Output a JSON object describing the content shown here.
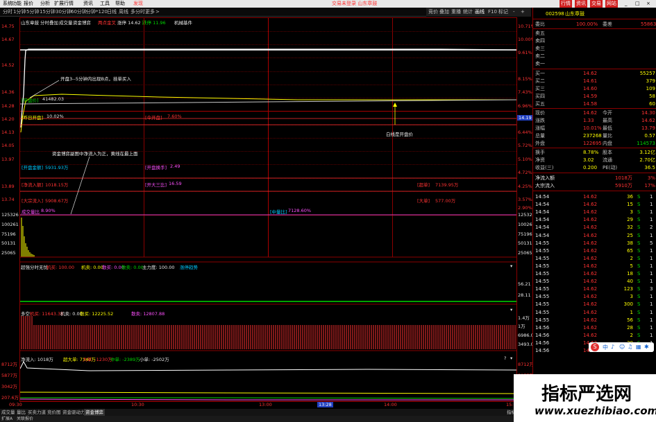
{
  "menubar": {
    "items": [
      "系统",
      "功能",
      "报价",
      "分析",
      "扩展行情",
      "资讯",
      "工具",
      "帮助",
      "发现"
    ],
    "window_title": "交易未登录  山东章鼓",
    "right_buttons": [
      "行情",
      "资讯",
      "交易",
      "网站"
    ]
  },
  "period_bar": {
    "items": [
      "分时",
      "1分钟",
      "5分钟",
      "15分钟",
      "30分钟",
      "60分钟",
      "分钟*120",
      "日线",
      "周线",
      "多分时",
      "更多"
    ]
  },
  "right_toolbar": {
    "items": [
      "竞价",
      "叠加",
      "重播",
      "统计",
      "画线",
      "F10",
      "标记",
      "-",
      "+"
    ]
  },
  "chart": {
    "header": {
      "name": "山东章鼓",
      "tabs": [
        "分时",
        "叠加",
        "成交量",
        "资金博弈",
        "两点金叉",
        "涨停"
      ],
      "price_text": "涨停 14.62",
      "drop_text": "跌停 11.96",
      "sector": "机械基件"
    },
    "left_price_ticks": [
      "14.75",
      "14.67",
      "14.52",
      "14.36",
      "14.28",
      "14.20",
      "14.13",
      "14.05",
      "13.97",
      "13.89",
      "13.74"
    ],
    "right_pct_ticks": [
      "10.71%",
      "10.00%",
      "9.61%",
      "8.15%",
      "7.43%",
      "6.96%",
      "6.44%",
      "5.72%",
      "5.10%",
      "4.72%",
      "4.25%",
      "3.57%",
      "2.90%"
    ],
    "current_price_label": "14.19",
    "volume_left_ticks": [
      "125326",
      "100261",
      "75196",
      "50131",
      "25065"
    ],
    "volume_right_ticks": [
      "125326",
      "100261",
      "75196",
      "50131",
      "25065"
    ],
    "info_labels": {
      "open_label": "[开盘价]",
      "open_value": "41482.03",
      "prev_close_label": "[昨日开盘]",
      "prev_close_value": "10.02%",
      "today_label": "[今开盘]",
      "today_value": "7.60%",
      "money_label": "[开盘金额]",
      "money_value": "5931.93万",
      "turnover_label": "[开盘换手]",
      "turnover_value": "2.49",
      "netflow_label": "[净流入额]",
      "netflow_value": "1018.15万",
      "big3_label": "[开大三比]",
      "big3_value": "16.59",
      "superbig_label": "[超单]",
      "superbig_value": "7139.95万",
      "big_label": "[大宗流入]",
      "big_value": "5908.67万",
      "big2_label": "[大单]",
      "big2_value": "577.00万",
      "ratio_label": "成交量比",
      "ratio_value": "8.90%",
      "total_label": "[中量比]",
      "total_value": "7128.60%"
    },
    "annotations": {
      "a1": "开盘3--5分钟内出现B点，挂单买入",
      "a2": "资金博弈副图中净流入为正，黄线在最上面",
      "a3": "白线是开盘价"
    },
    "panel1": {
      "title": "超强分时无忧",
      "labels": [
        "机买: 100.00",
        "机卖: 0.00",
        "散买: 0.00",
        "散卖: 0.00",
        "主力度: 100.00"
      ],
      "extra": "涨停趋势",
      "right_ticks": [
        "56.21",
        "28.11"
      ]
    },
    "panel2": {
      "title": "多空",
      "labels": [
        "机买: 11643.35",
        "机卖: 0.00",
        "散买: 12225.52",
        "散卖: 12807.88"
      ],
      "right_ticks": [
        "1.4万",
        "1万",
        "6986.01",
        "3493.01"
      ]
    },
    "panel3": {
      "title": "净流入: 1018万",
      "labels": [
        "超大单: 7140万",
        "大单: -1230万",
        "中单: -2389万",
        "小单: -2502万"
      ],
      "left_ticks": [
        "8712万",
        "5877万",
        "3042万",
        "207.6万"
      ],
      "right_ticks": [
        "8712万",
        "5877万",
        "3042万",
        "207.6万"
      ]
    },
    "time_ticks": [
      "09:30",
      "10:30",
      "13:00",
      "13:28",
      "14:00",
      "15:00"
    ]
  },
  "quote": {
    "code": "002598",
    "name": "山东章鼓",
    "webi_label": "委比",
    "webi_value": "100.00%",
    "weicha_label": "委差",
    "weicha_value": "55863",
    "sell": [
      {
        "label": "卖五",
        "price": "",
        "vol": ""
      },
      {
        "label": "卖四",
        "price": "",
        "vol": ""
      },
      {
        "label": "卖三",
        "price": "",
        "vol": ""
      },
      {
        "label": "卖二",
        "price": "",
        "vol": ""
      },
      {
        "label": "卖一",
        "price": "",
        "vol": ""
      }
    ],
    "buy": [
      {
        "label": "买一",
        "price": "14.62",
        "vol": "55257"
      },
      {
        "label": "买二",
        "price": "14.61",
        "vol": "379"
      },
      {
        "label": "买三",
        "price": "14.60",
        "vol": "109"
      },
      {
        "label": "买四",
        "price": "14.59",
        "vol": "58"
      },
      {
        "label": "买五",
        "price": "14.58",
        "vol": "60"
      }
    ],
    "stats": [
      {
        "l1": "现价",
        "v1": "14.62",
        "l2": "今开",
        "v2": "14.30"
      },
      {
        "l1": "涨跌",
        "v1": "1.33",
        "l2": "最高",
        "v2": "14.62"
      },
      {
        "l1": "涨幅",
        "v1": "10.01%",
        "l2": "最低",
        "v2": "13.79"
      },
      {
        "l1": "总量",
        "v1": "237268",
        "l2": "量比",
        "v2": "0.57"
      },
      {
        "l1": "外盘",
        "v1": "122695",
        "l2": "内盘",
        "v2": "114573"
      }
    ],
    "stats2": [
      {
        "l1": "换手",
        "v1": "8.78%",
        "l2": "股本",
        "v2": "3.12亿"
      },
      {
        "l1": "净资",
        "v1": "3.02",
        "l2": "流通",
        "v2": "2.70亿"
      },
      {
        "l1": "收益(三)",
        "v1": "0.200",
        "l2": "PE(动)",
        "v2": "36.5"
      }
    ],
    "flow": [
      {
        "label": "净流入额",
        "value": "1018万",
        "pct": "3%"
      },
      {
        "label": "大宗流入",
        "value": "5910万",
        "pct": "17%"
      }
    ],
    "ticks": [
      {
        "t": "14:54",
        "p": "14.62",
        "v": "36",
        "d": "S",
        "n": "1"
      },
      {
        "t": "14:54",
        "p": "14.62",
        "v": "15",
        "d": "S",
        "n": "1"
      },
      {
        "t": "14:54",
        "p": "14.62",
        "v": "3",
        "d": "S",
        "n": "1"
      },
      {
        "t": "14:54",
        "p": "14.62",
        "v": "29",
        "d": "S",
        "n": "1"
      },
      {
        "t": "14:54",
        "p": "14.62",
        "v": "32",
        "d": "S",
        "n": "2"
      },
      {
        "t": "14:54",
        "p": "14.62",
        "v": "25",
        "d": "S",
        "n": "1"
      },
      {
        "t": "14:55",
        "p": "14.62",
        "v": "38",
        "d": "S",
        "n": "5"
      },
      {
        "t": "14:55",
        "p": "14.62",
        "v": "65",
        "d": "S",
        "n": "1"
      },
      {
        "t": "14:55",
        "p": "14.62",
        "v": "2",
        "d": "S",
        "n": "1"
      },
      {
        "t": "14:55",
        "p": "14.62",
        "v": "5",
        "d": "S",
        "n": "1"
      },
      {
        "t": "14:55",
        "p": "14.62",
        "v": "18",
        "d": "S",
        "n": "1"
      },
      {
        "t": "14:55",
        "p": "14.62",
        "v": "40",
        "d": "S",
        "n": "1"
      },
      {
        "t": "14:55",
        "p": "14.62",
        "v": "123",
        "d": "S",
        "n": "3"
      },
      {
        "t": "14:55",
        "p": "14.62",
        "v": "3",
        "d": "S",
        "n": "1"
      },
      {
        "t": "14:55",
        "p": "14.62",
        "v": "300",
        "d": "S",
        "n": "1"
      },
      {
        "t": "14:55",
        "p": "14.62",
        "v": "1",
        "d": "S",
        "n": "1"
      },
      {
        "t": "14:55",
        "p": "14.62",
        "v": "56",
        "d": "S",
        "n": "1"
      },
      {
        "t": "14:56",
        "p": "14.62",
        "v": "28",
        "d": "S",
        "n": "1"
      },
      {
        "t": "14:56",
        "p": "14.62",
        "v": "2",
        "d": "S",
        "n": "1"
      },
      {
        "t": "14:56",
        "p": "14.62",
        "v": "20",
        "d": "S",
        "n": "1"
      },
      {
        "t": "14:56",
        "p": "14.62",
        "v": "3",
        "d": "S",
        "n": "1"
      }
    ]
  },
  "bottom_tabs": [
    "成交量",
    "量比",
    "买卖力道",
    "竞价图",
    "资金驱动力",
    "资金博弈"
  ],
  "bottom_right_label": "指标",
  "status": {
    "left": "扩展A",
    "right": "关联报价"
  },
  "watermark": {
    "title": "指标严选网",
    "url": "www.xuezhibiao.com"
  },
  "input_bar": {
    "label": "中"
  }
}
